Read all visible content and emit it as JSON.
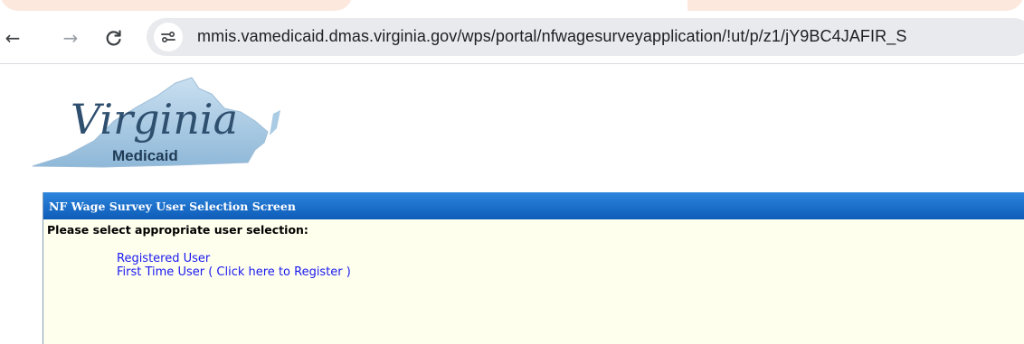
{
  "browser": {
    "url": "mmis.vamedicaid.dmas.virginia.gov/wps/portal/nfwagesurveyapplication/!ut/p/z1/jY9BC4JAFIR_S",
    "back_icon": "←",
    "forward_icon": "→",
    "reload_icon": "C"
  },
  "logo": {
    "script_text": "Virginia",
    "subtitle": "Medicaid",
    "map_color": "#a9cbe3"
  },
  "panel": {
    "title": "NF Wage Survey User Selection Screen",
    "prompt": "Please select appropriate user selection:",
    "options": [
      "Registered User",
      "First Time User ( Click here to Register )"
    ]
  },
  "colors": {
    "header_blue": "#0d5cb8",
    "panel_bg": "#ffffee",
    "link": "#1a1aee"
  }
}
